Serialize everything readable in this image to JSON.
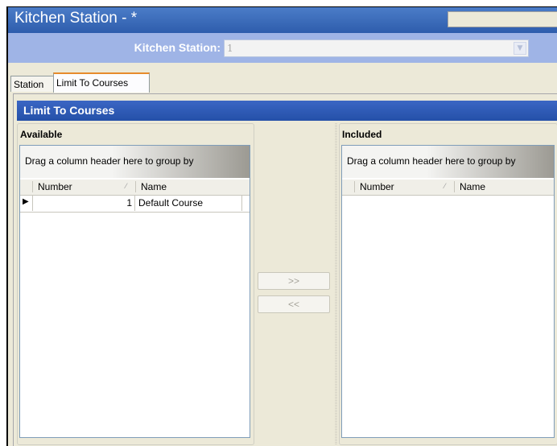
{
  "window": {
    "title": "Kitchen Station - *"
  },
  "header": {
    "kitchen_station_label": "Kitchen Station:",
    "kitchen_station_value": "1"
  },
  "tabs": [
    {
      "label": "Station",
      "active": false
    },
    {
      "label": "Limit To Courses",
      "active": true
    }
  ],
  "section": {
    "title": "Limit To Courses"
  },
  "available": {
    "title": "Available",
    "group_by_hint": "Drag a column header here to group by",
    "columns": [
      "Number",
      "Name"
    ],
    "rows": [
      {
        "number": "1",
        "name": "Default Course"
      }
    ]
  },
  "included": {
    "title": "Included",
    "group_by_hint": "Drag a column header here to group by",
    "columns": [
      "Number",
      "Name"
    ],
    "rows": []
  },
  "buttons": {
    "add": ">>",
    "remove": "<<"
  },
  "colors": {
    "title_bar": "#3a6cc0",
    "header_band": "#9fb4e6",
    "section_header": "#2f5bb7",
    "active_tab_accent": "#e68b2c"
  }
}
